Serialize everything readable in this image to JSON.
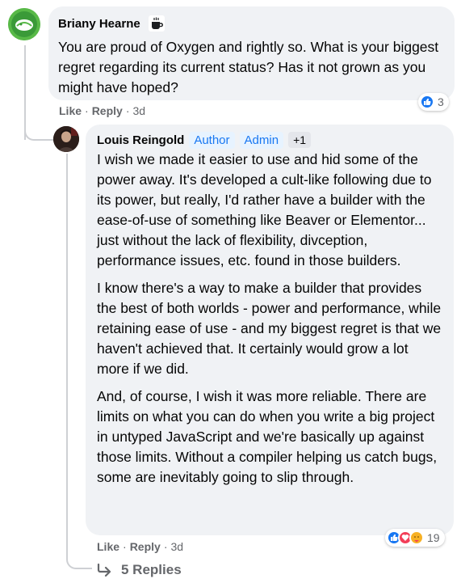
{
  "comment": {
    "author": "Briany Hearne",
    "badge_icon": "coffee-cup-icon",
    "text": "You are proud of Oxygen and rightly so. What is your biggest regret regarding its current status? Has it not grown as you might have hoped?",
    "actions": {
      "like": "Like",
      "reply": "Reply",
      "time": "3d",
      "dot": "·"
    },
    "reactions": {
      "types": [
        "like"
      ],
      "count": "3"
    }
  },
  "reply": {
    "author": "Louis Reingold",
    "badges": {
      "author": "Author",
      "admin": "Admin",
      "plus": "+1"
    },
    "paragraphs": [
      "I wish we made it easier to use and hid some of the power away. It's developed a cult-like following due to its power, but really, I'd rather have a builder with the ease-of-use of something like Beaver or Elementor... just without the lack of flexibility, divception, performance issues, etc. found in those builders.",
      "I know there's a way to make a builder that provides the best of both worlds - power and performance, while retaining ease of use - and my biggest regret is that we haven't achieved that. It certainly would grow a lot more if we did.",
      "And, of course, I wish it was more reliable. There are limits on what you can do when you write a big project in untyped JavaScript and we're basically up against those limits. Without a compiler helping us catch bugs, some are inevitably going to slip through."
    ],
    "actions": {
      "like": "Like",
      "reply": "Reply",
      "time": "3d",
      "dot": "·"
    },
    "reactions": {
      "types": [
        "like",
        "love",
        "care"
      ],
      "count": "19"
    }
  },
  "replies_link": {
    "label": "5 Replies",
    "icon": "reply-arrow-icon"
  },
  "colors": {
    "link_blue": "#1877f2",
    "bubble_bg": "#f0f2f5",
    "muted": "#65676b",
    "thread_line": "#ced0d4"
  }
}
